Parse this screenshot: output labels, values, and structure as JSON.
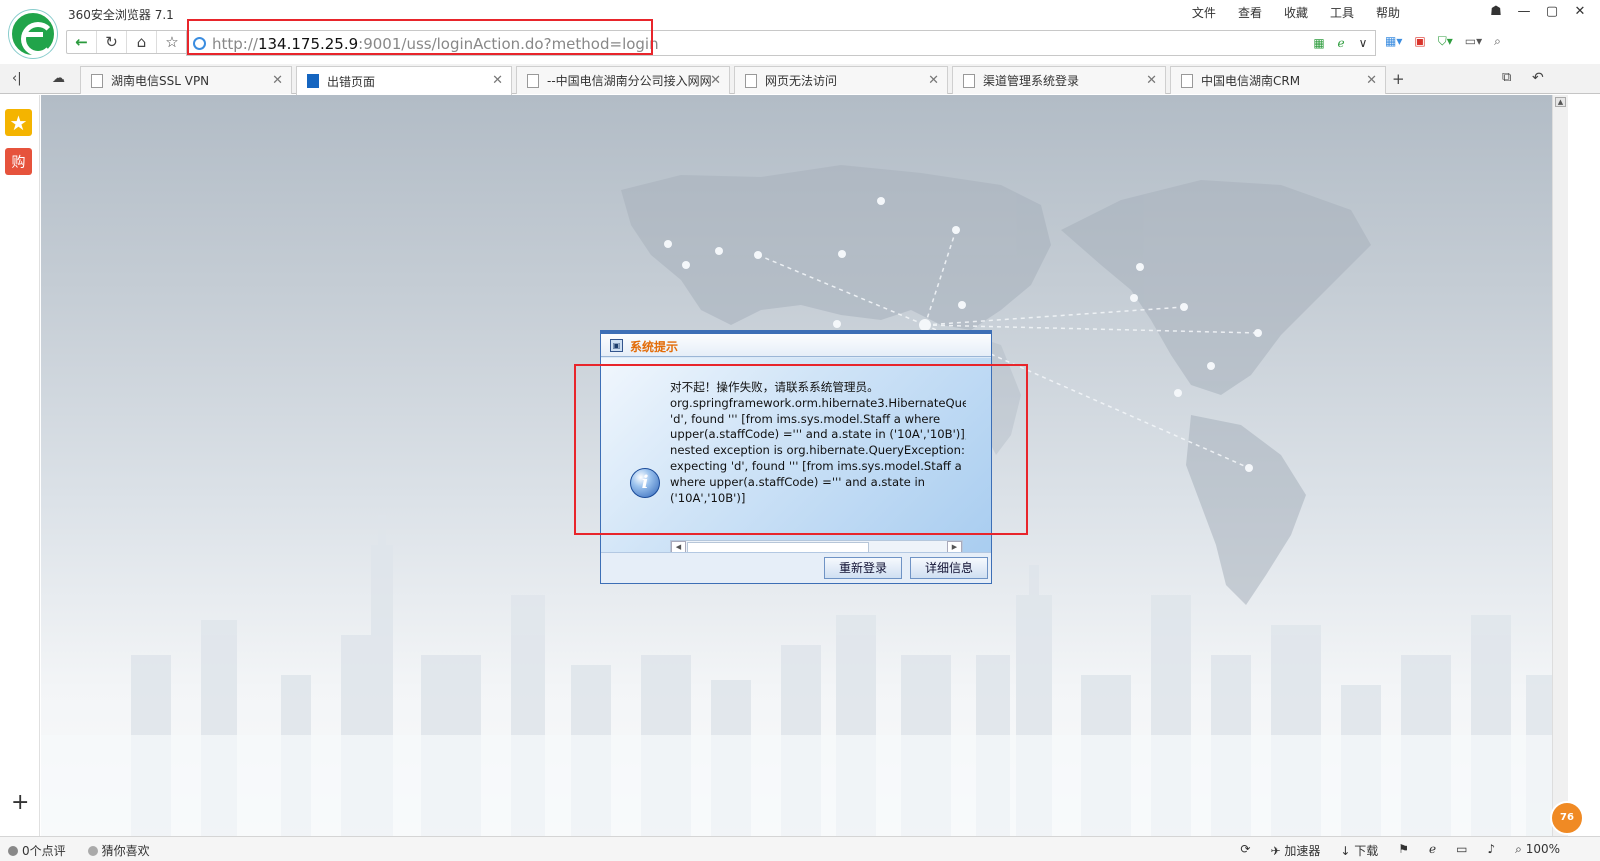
{
  "window": {
    "title": "360安全浏览器 7.1",
    "menu": [
      "文件",
      "查看",
      "收藏",
      "工具",
      "帮助"
    ],
    "controls": [
      "☗",
      "—",
      "▢",
      "✕"
    ]
  },
  "address_bar": {
    "url_scheme": "http://",
    "url_host": "134.175.25.9",
    "url_rest": ":9001/uss/loginAction.do?method=login"
  },
  "tabs": [
    {
      "label": "湖南电信SSL VPN",
      "active": false
    },
    {
      "label": "出错页面",
      "active": true
    },
    {
      "label": "--中国电信湖南分公司接入网网",
      "active": false
    },
    {
      "label": "网页无法访问",
      "active": false
    },
    {
      "label": "渠道管理系统登录",
      "active": false
    },
    {
      "label": "中国电信湖南CRM",
      "active": false
    }
  ],
  "sidebar": {
    "shop_label": "购"
  },
  "dialog": {
    "title": "系统提示",
    "icon_glyph": "i",
    "message_lines": [
      "对不起！操作失败，请联系系统管理员。",
      "org.springframework.orm.hibernate3.HibernateQue",
      "'d', found ''' [from ims.sys.model.Staff a where",
      "upper(a.staffCode) =''' and a.state in ('10A','10B')];",
      "nested exception is org.hibernate.QueryException:",
      "expecting 'd', found ''' [from ims.sys.model.Staff a",
      "where upper(a.staffCode) =''' and a.state in",
      "('10A','10B')]"
    ],
    "buttons": {
      "relogin": "重新登录",
      "details": "详细信息"
    }
  },
  "statusbar": {
    "reviews": "0个点评",
    "guess": "猜你喜欢",
    "accelerator": "加速器",
    "download": "下载",
    "zoom": "100%",
    "badge": "76"
  },
  "colors": {
    "highlight": "#e8252b",
    "dialog_border": "#3d6fb6",
    "dialog_title": "#e36c09"
  }
}
